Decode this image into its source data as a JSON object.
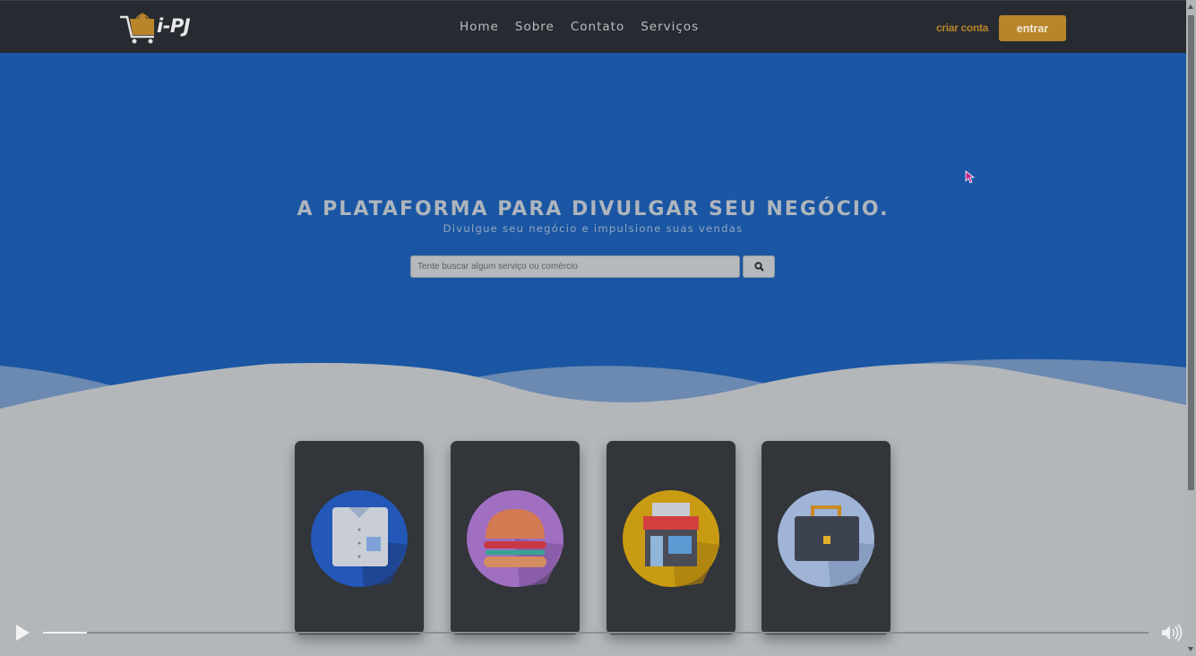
{
  "header": {
    "logo_text": "i-PJ",
    "nav": [
      "Home",
      "Sobre",
      "Contato",
      "Serviços"
    ],
    "create_account": "criar conta",
    "login": "entrar"
  },
  "hero": {
    "title": "A PLATAFORMA PARA DIVULGAR SEU NEGÓCIO.",
    "subtitle": "Divulgue seu negócio e impulsione suas vendas",
    "search_placeholder": "Tente buscar algum serviço ou comércio"
  },
  "categories": [
    {
      "icon": "shirt-icon",
      "color": "#2357b8"
    },
    {
      "icon": "burger-icon",
      "color": "#a06fc2"
    },
    {
      "icon": "storefront-icon",
      "color": "#c99b12"
    },
    {
      "icon": "briefcase-icon",
      "color": "#9fb4d6"
    }
  ],
  "video": {
    "progress": 0.04
  },
  "colors": {
    "header": "#272b31",
    "hero": "#1a56a3",
    "accent": "#b8852b",
    "card": "#323539"
  }
}
